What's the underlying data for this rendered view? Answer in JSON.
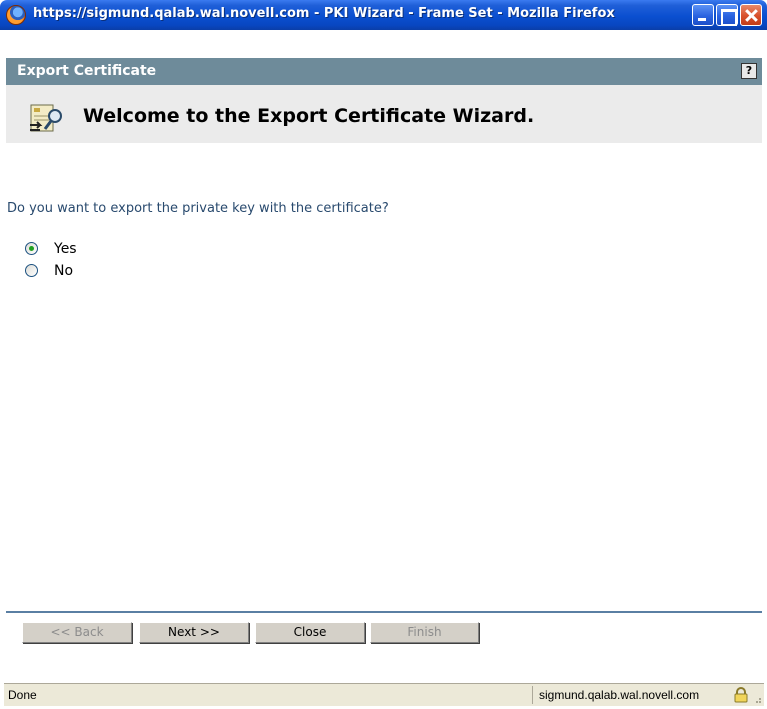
{
  "window": {
    "title": "https://sigmund.qalab.wal.novell.com - PKI Wizard - Frame Set - Mozilla Firefox"
  },
  "wizard": {
    "header_title": "Export Certificate",
    "help_label": "?",
    "welcome_text": "Welcome to the Export Certificate Wizard."
  },
  "form": {
    "question": "Do you want to export the private key with the certificate?",
    "options": [
      {
        "label": "Yes",
        "selected": true
      },
      {
        "label": "No",
        "selected": false
      }
    ]
  },
  "buttons": {
    "back": "<< Back",
    "next": "Next >>",
    "close": "Close",
    "finish": "Finish"
  },
  "statusbar": {
    "status": "Done",
    "host": "sigmund.qalab.wal.novell.com"
  },
  "colors": {
    "header_bar": "#6e8b9a",
    "radio_selected": "#21a121",
    "question_text": "#294a6e"
  }
}
